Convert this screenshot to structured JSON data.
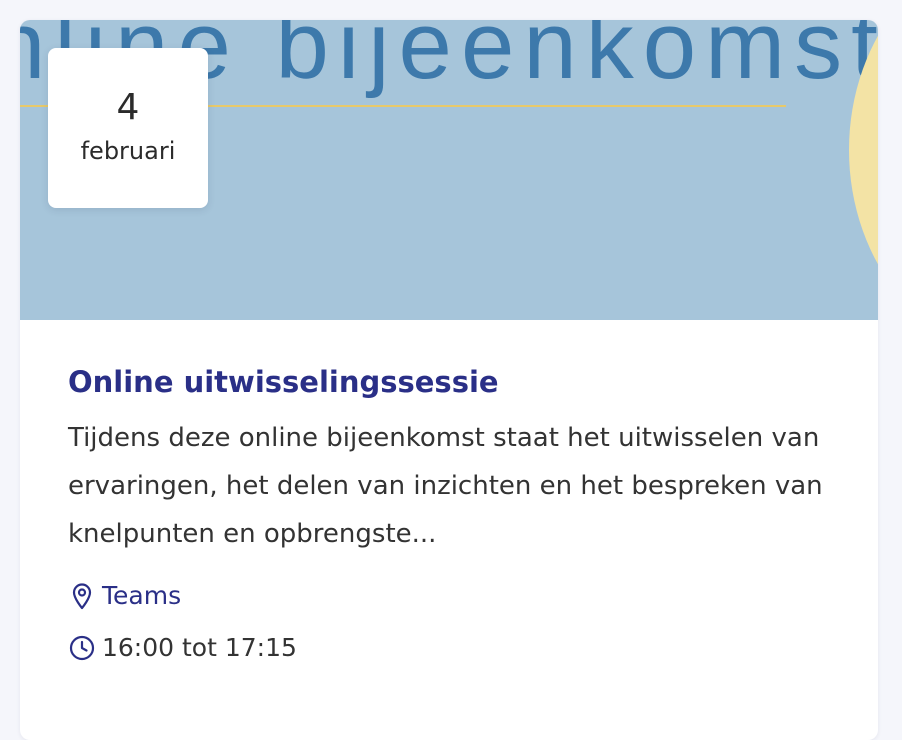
{
  "hero": {
    "banner_text": "nline bijeenkomst"
  },
  "date": {
    "day": "4",
    "month": "februari"
  },
  "event": {
    "title": "Online uitwisselingssessie",
    "description": "Tijdens deze online bijeenkomst staat het uitwisselen van ervaringen, het delen van inzichten en het bespreken van knelpunten en opbrengste...",
    "location": "Teams",
    "time": "16:00 tot 17:15"
  },
  "icons": {
    "location": "map-pin-icon",
    "time": "clock-icon"
  },
  "colors": {
    "page_background": "#f5f6fb",
    "hero_background": "#a6c5da",
    "hero_text": "#3d79ab",
    "hero_line": "#e7c96a",
    "hero_circle": "#f3e3a5",
    "title": "#2a2f87",
    "location_link": "#2a2f87",
    "body_text": "#333333"
  }
}
